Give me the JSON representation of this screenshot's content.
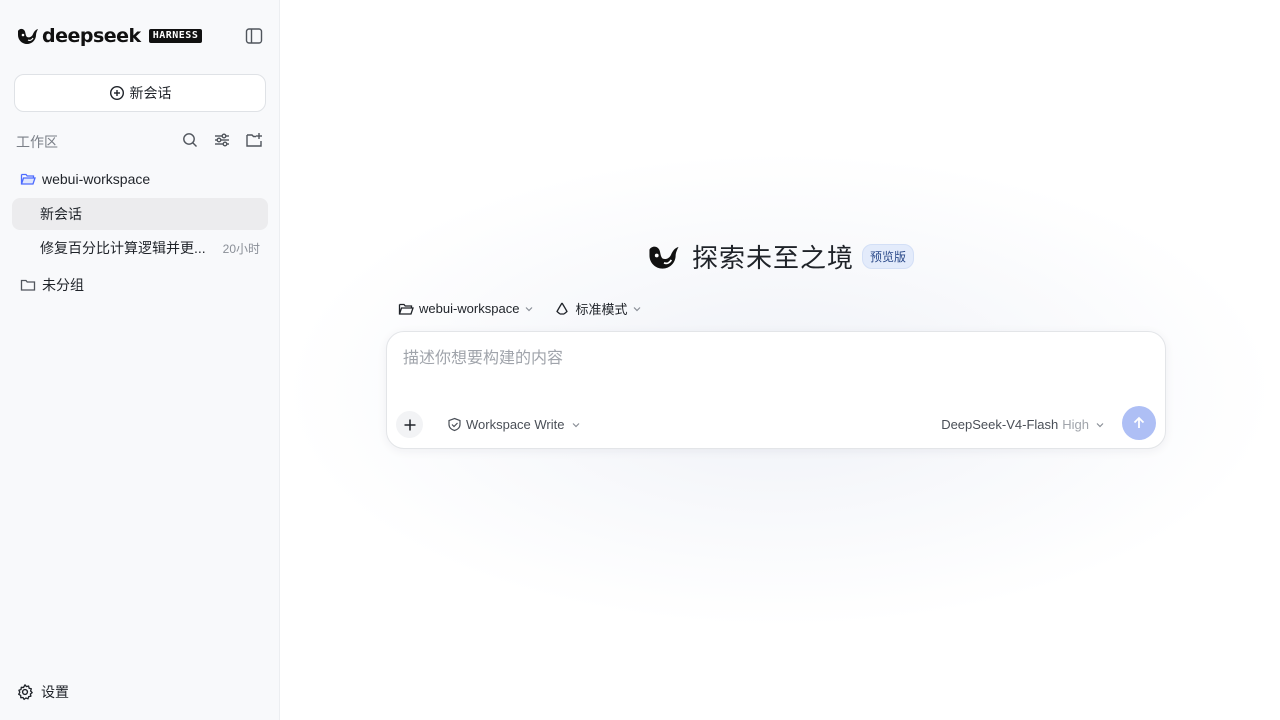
{
  "colors": {
    "accent": "#4d6bfe",
    "send_disabled": "#aebff5",
    "sidebar_bg": "#f8f9fb",
    "active_row": "#ececee",
    "folder_blue": "#4d6bfe"
  },
  "brand": {
    "name": "deepseek",
    "badge": "HARNESS",
    "logo_icon": "whale-icon"
  },
  "sidebar": {
    "new_chat_label": "新会话",
    "workspace_section_title": "工作区",
    "tools": [
      "search-icon",
      "filter-icon",
      "new-folder-icon"
    ],
    "folders": [
      {
        "name": "webui-workspace",
        "icon": "folder-open-icon"
      },
      {
        "name": "未分组",
        "icon": "folder-icon"
      }
    ],
    "chats": [
      {
        "title": "新会话",
        "time": "",
        "active": true
      },
      {
        "title": "修复百分比计算逻辑并更...",
        "time": "20小时",
        "active": false
      }
    ],
    "settings_label": "设置"
  },
  "main": {
    "title": "探索未至之境",
    "badge": "预览版",
    "workspace_selector": "webui-workspace",
    "mode_selector": "标准模式",
    "prompt_placeholder": "描述你想要构建的内容",
    "prompt_value": "",
    "permission": "Workspace Write",
    "model": "DeepSeek-V4-Flash",
    "effort": "High"
  }
}
